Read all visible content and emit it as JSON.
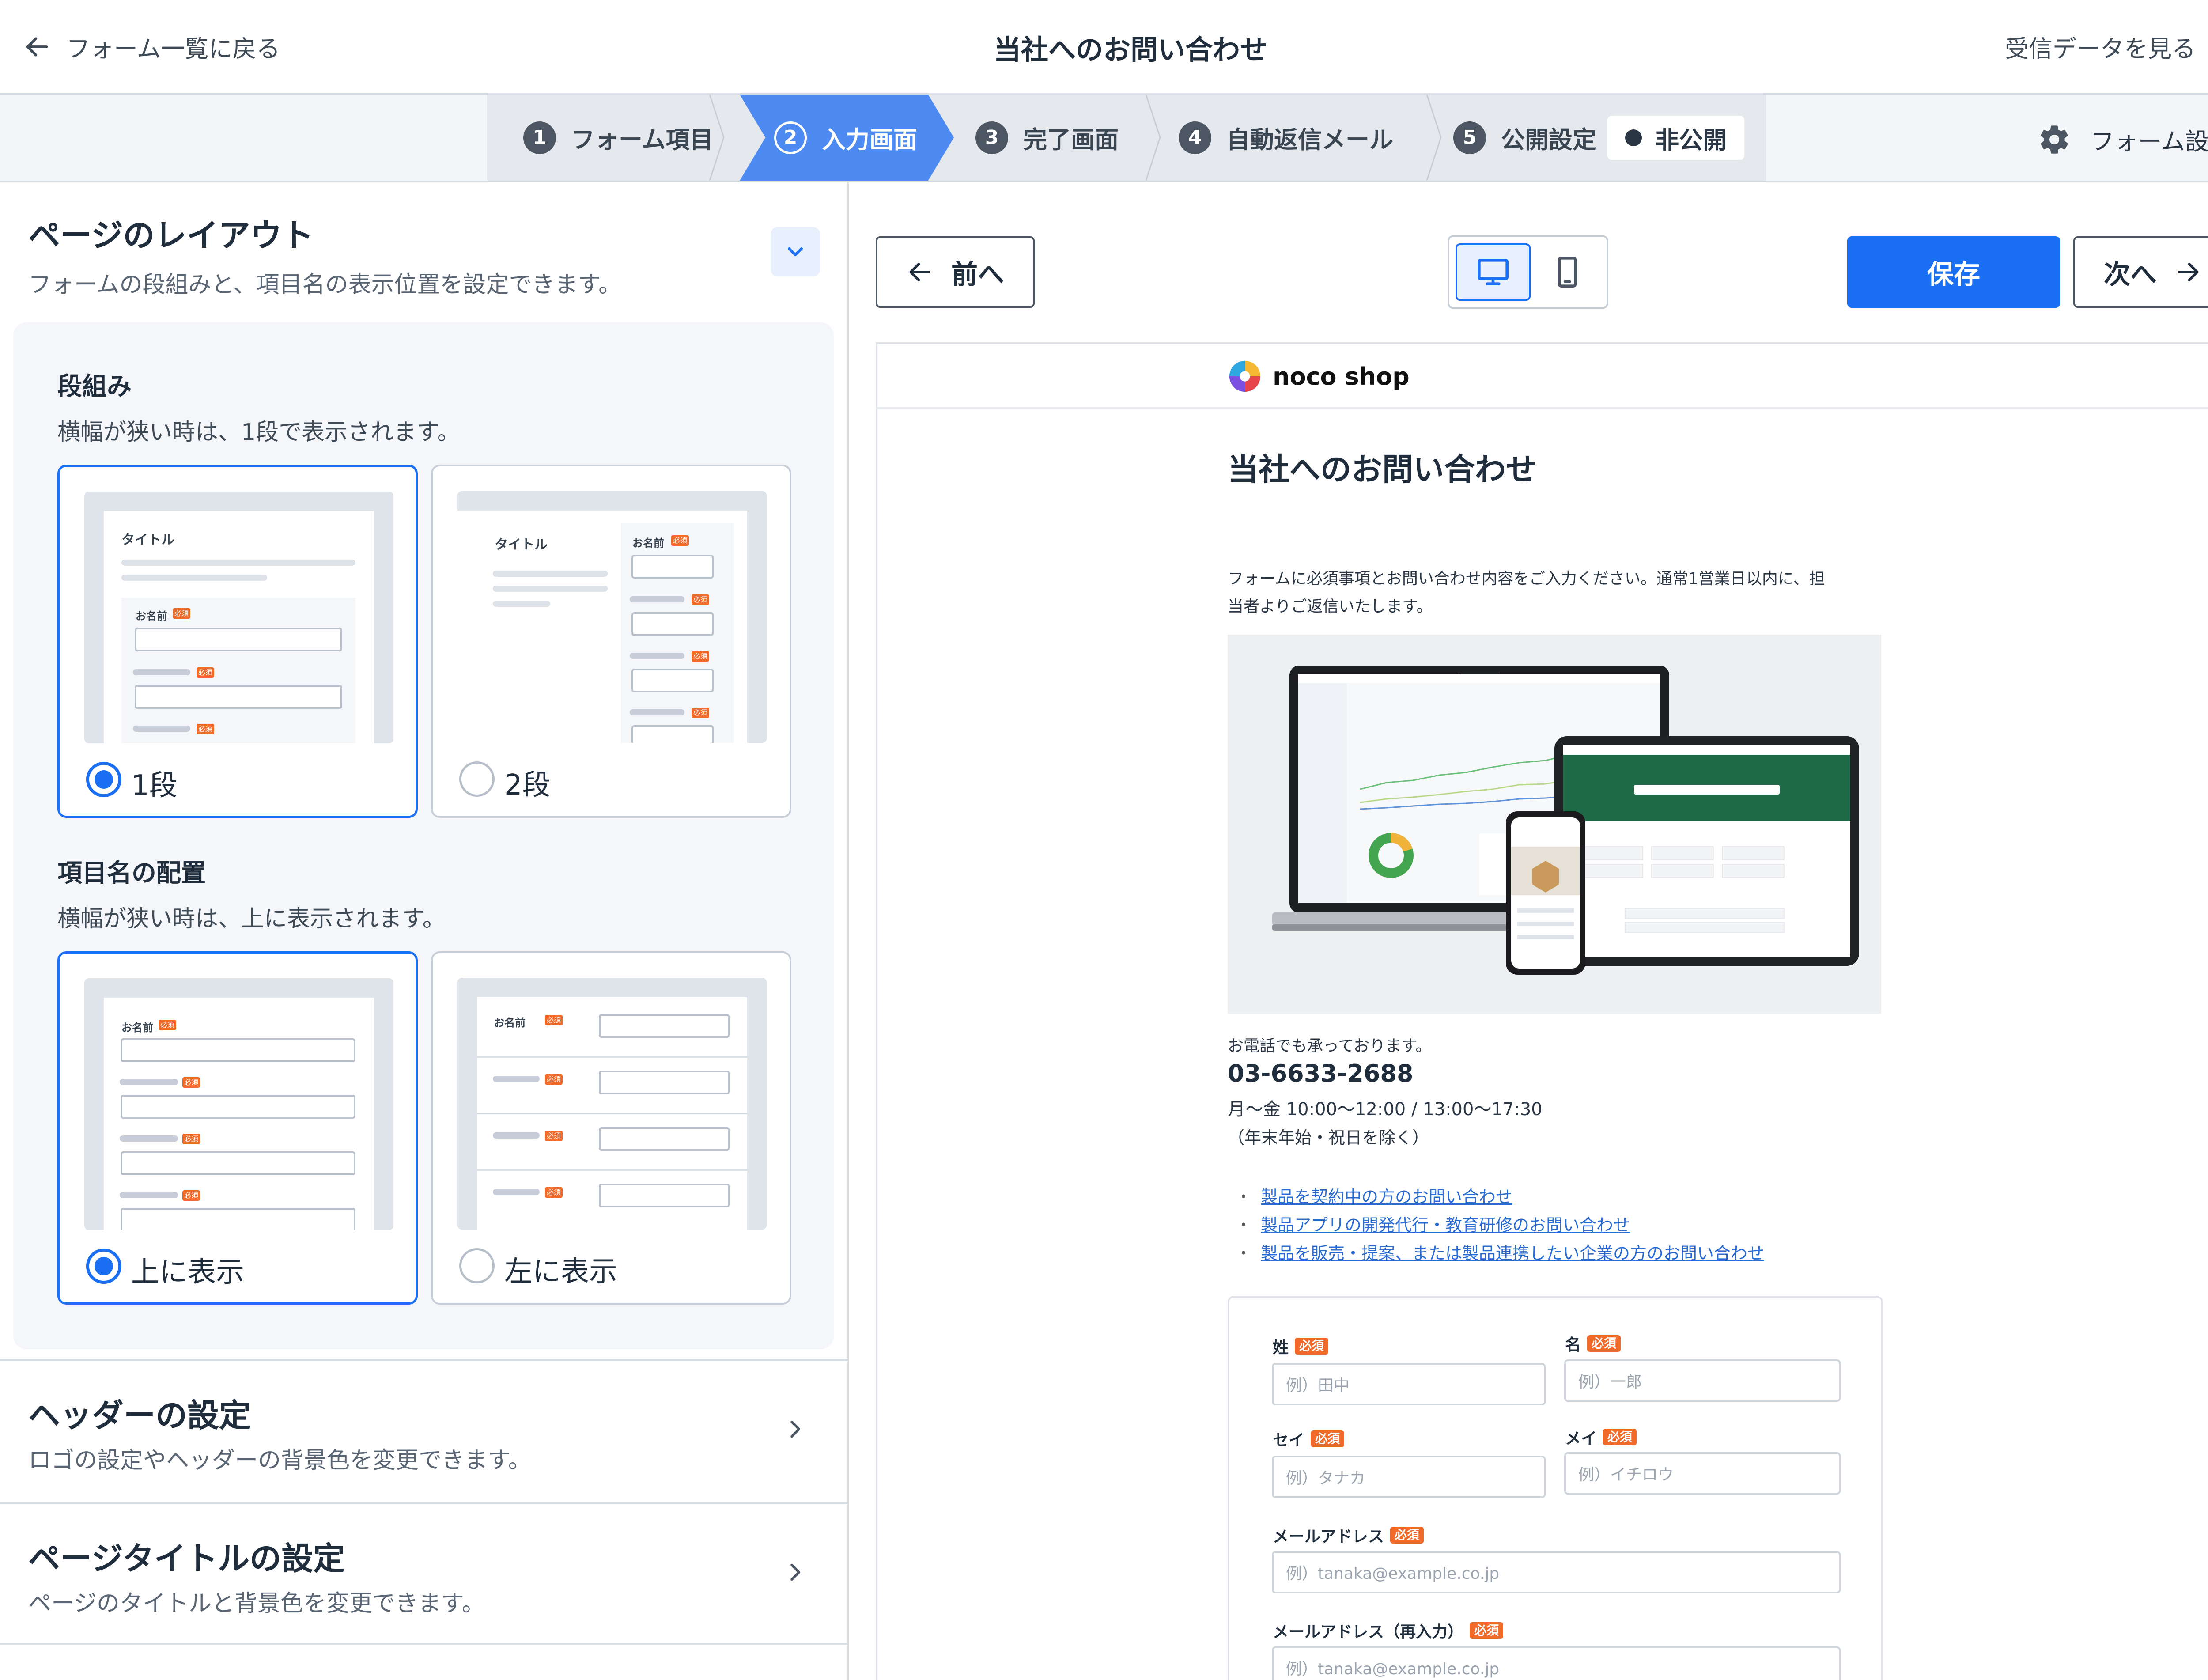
{
  "topbar": {
    "back_label": "フォーム一覧に戻る",
    "title": "当社へのお問い合わせ",
    "view_data_label": "受信データを見る"
  },
  "steps": [
    {
      "num": "1",
      "label": "フォーム項目"
    },
    {
      "num": "2",
      "label": "入力画面"
    },
    {
      "num": "3",
      "label": "完了画面"
    },
    {
      "num": "4",
      "label": "自動返信メール"
    },
    {
      "num": "5",
      "label": "公開設定"
    }
  ],
  "active_step": 2,
  "publish_status": "非公開",
  "form_settings_label": "フォーム設定",
  "layout_section": {
    "title": "ページのレイアウト",
    "desc": "フォームの段組みと、項目名の表示位置を設定できます。",
    "columns": {
      "title": "段組み",
      "desc": "横幅が狭い時は、1段で表示されます。",
      "options": [
        "1段",
        "2段"
      ],
      "selected": "1段"
    },
    "label_position": {
      "title": "項目名の配置",
      "desc": "横幅が狭い時は、上に表示されます。",
      "options": [
        "上に表示",
        "左に表示"
      ],
      "selected": "上に表示"
    },
    "thumb": {
      "title": "タイトル",
      "name_label": "お名前",
      "required": "必須"
    }
  },
  "header_section": {
    "title": "ヘッダーの設定",
    "desc": "ロゴの設定やヘッダーの背景色を変更できます。"
  },
  "page_title_section": {
    "title": "ページタイトルの設定",
    "desc": "ページのタイトルと背景色を変更できます。"
  },
  "toolbar": {
    "prev_label": "前へ",
    "save_label": "保存",
    "next_label": "次へ"
  },
  "preview": {
    "logo_text": "noco shop",
    "title": "当社へのお問い合わせ",
    "intro_line1": "フォームに必須事項とお問い合わせ内容をご入力ください。通常1営業日以内に、担",
    "intro_line2": "当者よりご返信いたします。",
    "phone_lead": "お電話でも承っております。",
    "phone": "03-6633-2688",
    "hours": "月〜金 10:00〜12:00 / 13:00〜17:30",
    "holiday": "（年末年始・祝日を除く）",
    "links": [
      "製品を契約中の方のお問い合わせ",
      "製品アプリの開発代行・教育研修のお問い合わせ",
      "製品を販売・提案、または製品連携したい企業の方のお問い合わせ"
    ],
    "form": {
      "required": "必須",
      "last_name": {
        "label": "姓",
        "placeholder": "例）田中"
      },
      "first_name": {
        "label": "名",
        "placeholder": "例）一郎"
      },
      "last_kana": {
        "label": "セイ",
        "placeholder": "例）タナカ"
      },
      "first_kana": {
        "label": "メイ",
        "placeholder": "例）イチロウ"
      },
      "email": {
        "label": "メールアドレス",
        "placeholder": "例）tanaka@example.co.jp"
      },
      "email_confirm": {
        "label": "メールアドレス（再入力）",
        "placeholder": "例）tanaka@example.co.jp"
      }
    }
  },
  "colors": {
    "accent": "#1a6ff2",
    "step_active": "#4d8af2",
    "required_badge": "#f06a2a",
    "link": "#2a6bd1"
  }
}
